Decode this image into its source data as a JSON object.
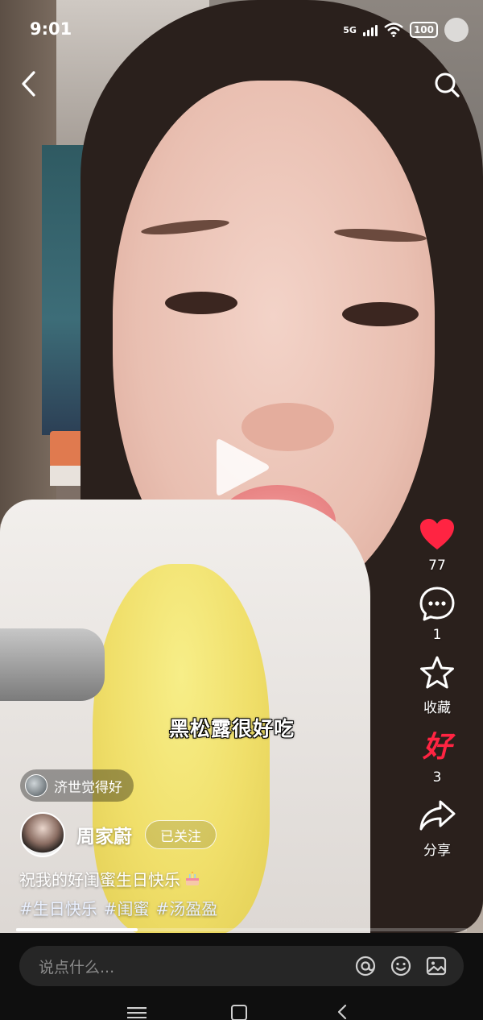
{
  "status_bar": {
    "time": "9:01",
    "network": "5G",
    "battery": "100"
  },
  "overlay": {
    "subtitle": "黑松露很好吃"
  },
  "actions": {
    "like_count": "77",
    "comment_count": "1",
    "collect_label": "收藏",
    "hao_glyph": "好",
    "hao_count": "3",
    "share_label": "分享"
  },
  "friend_chip": {
    "text": "济世觉得好"
  },
  "author": {
    "name": "周家蔚",
    "follow_label": "已关注"
  },
  "caption": {
    "text": "祝我的好闺蜜生日快乐"
  },
  "tags": [
    "#生日快乐",
    "#闺蜜",
    "#汤盈盈"
  ],
  "progress": {
    "fraction": 0.27
  },
  "comment_input": {
    "placeholder": "说点什么..."
  },
  "colors": {
    "like_red": "#ff2442",
    "tag_color": "#e9f0ff"
  }
}
